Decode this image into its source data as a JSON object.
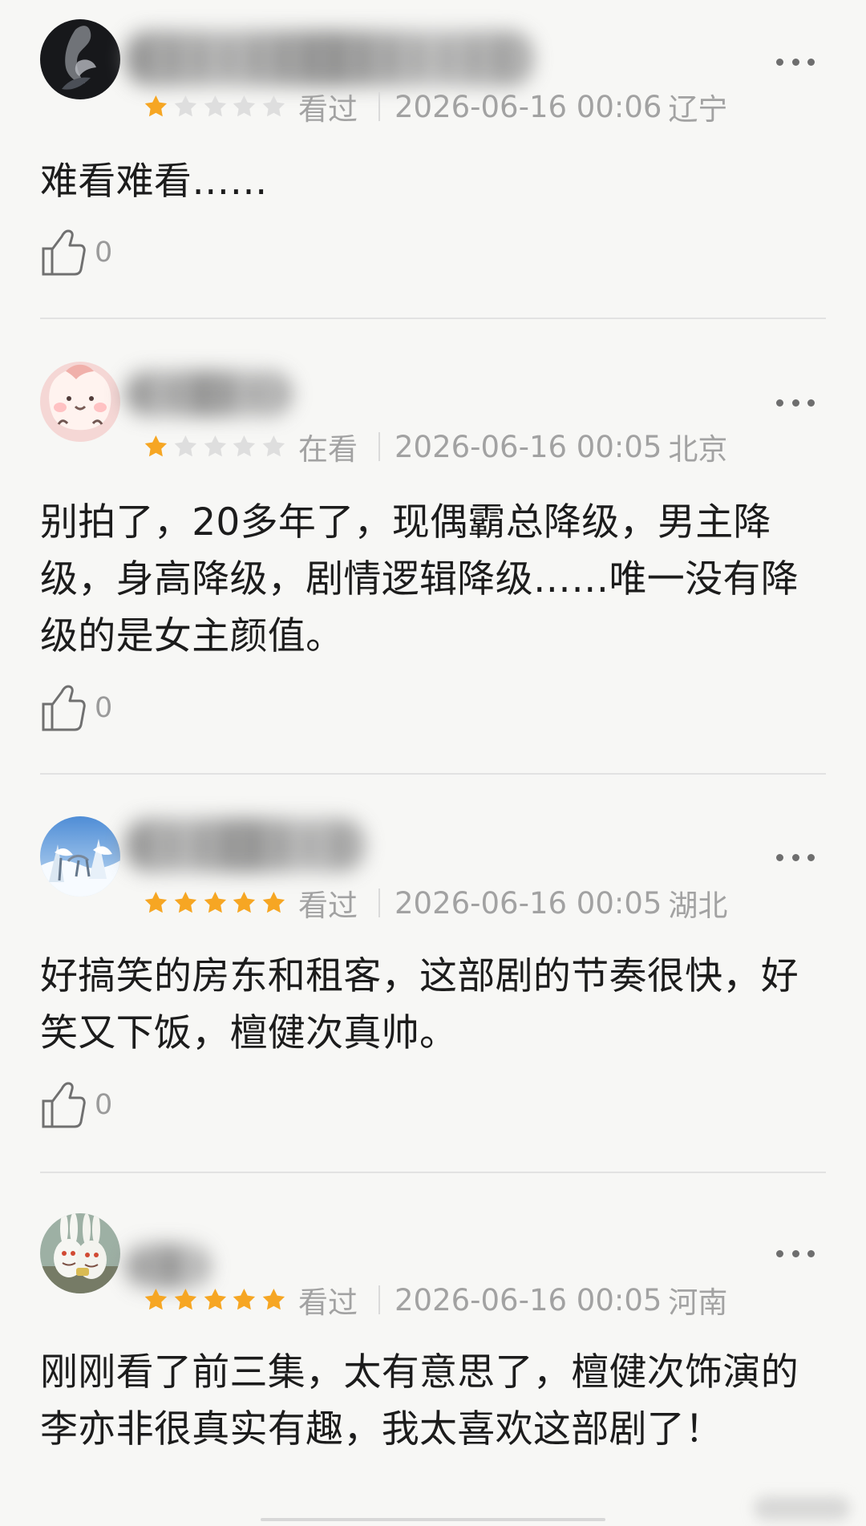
{
  "reviews": [
    {
      "rating": 1,
      "status": "看过",
      "date": "2026-06-16 00:06",
      "region": "辽宁",
      "content": "难看难看……",
      "likes": "0",
      "avatar_icon": "avatar-dark-hand-icon"
    },
    {
      "rating": 1,
      "status": "在看",
      "date": "2026-06-16 00:05",
      "region": "北京",
      "content": "别拍了，20多年了，现偶霸总降级，男主降级，身高降级，剧情逻辑降级……唯一没有降级的是女主颜值。",
      "likes": "0",
      "avatar_icon": "avatar-pink-cartoon-icon"
    },
    {
      "rating": 5,
      "status": "看过",
      "date": "2026-06-16 00:05",
      "region": "湖北",
      "content": "好搞笑的房东和租客，这部剧的节奏很快，好笑又下饭，檀健次真帅。",
      "likes": "0",
      "avatar_icon": "avatar-snow-scene-icon"
    },
    {
      "rating": 5,
      "status": "看过",
      "date": "2026-06-16 00:05",
      "region": "河南",
      "content": "刚刚看了前三集，太有意思了，檀健次饰演的李亦非很真实有趣，我太喜欢这部剧了！",
      "likes": "",
      "avatar_icon": "avatar-rabbits-icon"
    }
  ],
  "colors": {
    "background": "#f7f7f5",
    "star_active": "#f6a623",
    "star_inactive": "#dedede",
    "meta": "#a2a2a2",
    "divider": "#e2e2e2"
  }
}
